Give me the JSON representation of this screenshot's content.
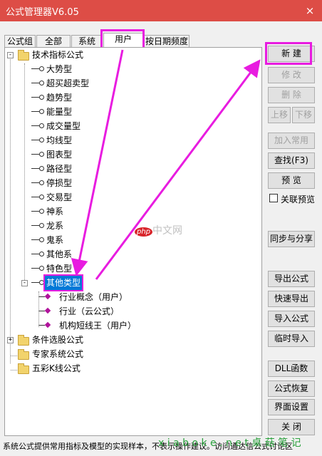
{
  "window": {
    "title": "公式管理器V6.05",
    "close_glyph": "×"
  },
  "tabs": [
    "公式组",
    "全部",
    "系统",
    "用户",
    "按日期频度"
  ],
  "tree": {
    "tech": {
      "label": "技术指标公式",
      "expander": "-"
    },
    "tech_children": [
      "大势型",
      "超买超卖型",
      "趋势型",
      "能量型",
      "成交量型",
      "均线型",
      "图表型",
      "路径型",
      "停损型",
      "交易型",
      "神系",
      "龙系",
      "鬼系",
      "其他系",
      "特色型"
    ],
    "other_type": {
      "label": "其他类型",
      "expander": "-"
    },
    "other_children": [
      "行业概念（用户）",
      "行业（云公式）",
      "机构短线王（用户）"
    ],
    "folders": [
      {
        "label": "条件选股公式",
        "expander": "+"
      },
      {
        "label": "专家系统公式",
        "expander": ""
      },
      {
        "label": "五彩K线公式",
        "expander": ""
      }
    ]
  },
  "buttons": {
    "new": "新 建",
    "edit": "修 改",
    "delete": "删 除",
    "move_up": "上移",
    "move_down": "下移",
    "add_common": "加入常用",
    "find": "查找(F3)",
    "preview": "预 览",
    "link_preview": "关联预览",
    "sync_share": "同步与分享",
    "export": "导出公式",
    "quick_export": "快速导出",
    "import": "导入公式",
    "temp_import": "临时导入",
    "dll": "DLL函数",
    "restore": "公式恢复",
    "ui_settings": "界面设置",
    "close": "关 闭"
  },
  "status_text": "系统公式提供常用指标及模型的实现样本，不表示操作建议。访问通达信公式讨论区",
  "watermarks": {
    "center_logo": "php",
    "center_text": "中文网",
    "bottom": "x i a b o k e . n e t  桌 菇 笔 记"
  },
  "colors": {
    "titlebar": "#dd4d46",
    "highlight": "#e81ce0",
    "selection": "#0078d7",
    "leaf_icon": "#b0139b"
  }
}
